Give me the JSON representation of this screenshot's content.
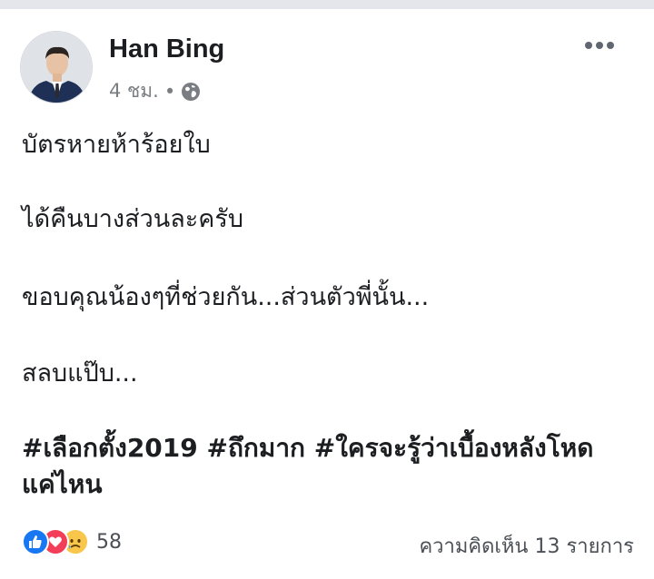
{
  "post": {
    "author": "Han Bing",
    "time": "4 ชม.",
    "separator": "•",
    "paragraphs": [
      "บัตรหายห้าร้อยใบ",
      "ได้คืนบางส่วนละครับ",
      "ขอบคุณน้องๆที่ช่วยกัน...ส่วนตัวพี่นั้น...",
      "สลบแป๊บ..."
    ],
    "hashtags": [
      "#เลือกตั้ง2019",
      "#ถึกมาก",
      "#ใครจะรู้ว่าเบื้องหลังโหดแค่ไหน"
    ]
  },
  "footer": {
    "reaction_count": "58",
    "comments_label": "ความคิดเห็น 13 รายการ"
  },
  "icons": {
    "globe": "globe-icon",
    "more": "more-options-icon",
    "like": "like-reaction-icon",
    "love": "love-reaction-icon",
    "sad": "sad-reaction-icon"
  },
  "colors": {
    "like": "#1877f2",
    "love": "#f33e58",
    "sad": "#f7c64a",
    "meta_text": "#7a7d82"
  }
}
